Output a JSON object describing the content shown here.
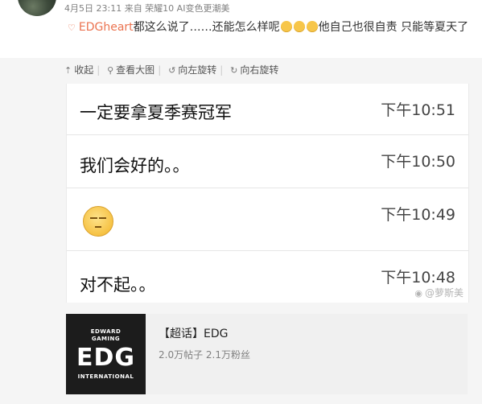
{
  "post": {
    "meta": "4月5日 23:11 来自 荣耀10 AI变色更潮美",
    "repost": {
      "tag": "EDGheart",
      "text_before_emoji": "都这么说了……还能怎么样呢",
      "text_after_emoji": "他自己也很自责 只能等夏天了",
      "emoji_count": 3
    }
  },
  "toolbar": {
    "collapse": "收起",
    "view_large": "查看大图",
    "rotate_left": "向左旋转",
    "rotate_right": "向右旋转"
  },
  "chat": {
    "messages": [
      {
        "text": "一定要拿夏季赛冠军",
        "time": "下午10:51"
      },
      {
        "text": "我们会好的。。",
        "time": "下午10:50"
      },
      {
        "text": "",
        "time": "下午10:49",
        "sticker": "unamused-face"
      },
      {
        "text": "对不起。。",
        "time": "下午10:48"
      }
    ],
    "watermark": "@萝斯美"
  },
  "topic_card": {
    "logo_line1": "EDWARD",
    "logo_line2": "GAMING",
    "logo_main": "EDG",
    "logo_line3": "INTERNATIONAL",
    "title": "【超话】EDG",
    "stats": "2.0万帖子 2.1万粉丝"
  },
  "colors": {
    "accent": "#eb7350",
    "background": "#f5f5f5"
  }
}
